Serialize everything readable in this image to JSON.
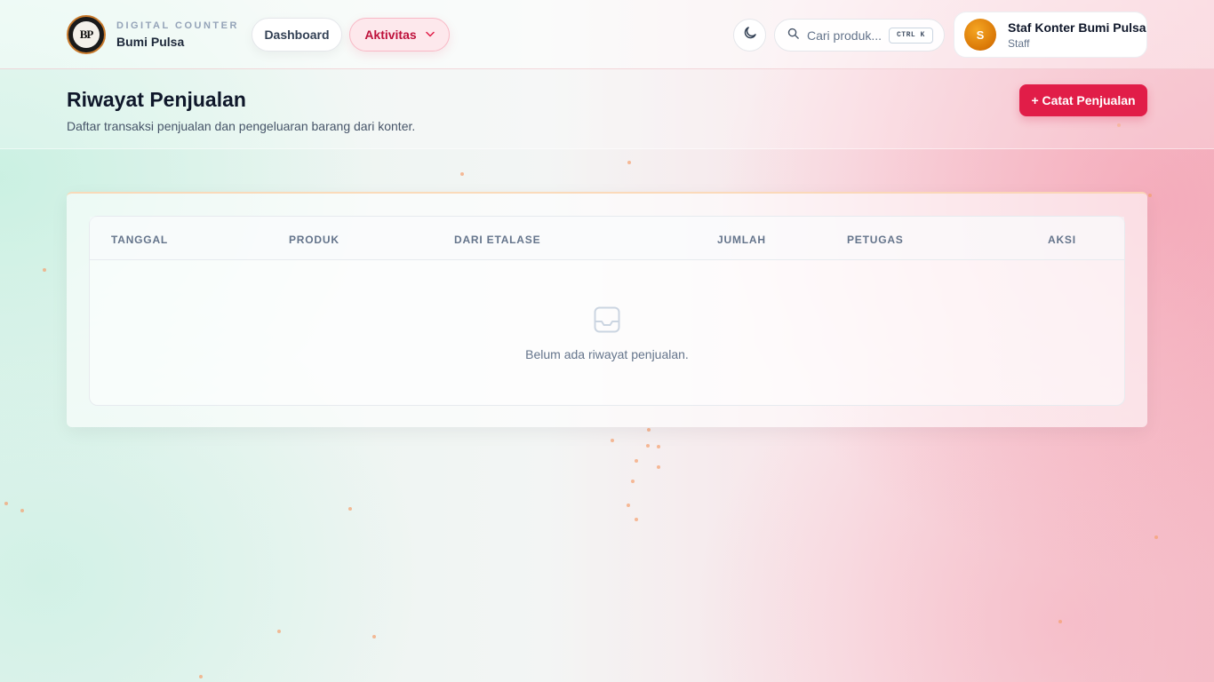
{
  "brand": {
    "logo_text": "BP",
    "subtitle": "DIGITAL COUNTER",
    "name": "Bumi Pulsa"
  },
  "nav": {
    "dashboard": "Dashboard",
    "aktivitas": "Aktivitas"
  },
  "search": {
    "placeholder": "Cari produk...",
    "shortcut": "CTRL K"
  },
  "user": {
    "initial": "S",
    "name": "Staf Konter Bumi Pulsa",
    "role": "Staff"
  },
  "page": {
    "title": "Riwayat Penjualan",
    "subtitle": "Daftar transaksi penjualan dan pengeluaran barang dari konter.",
    "add_button": "+ Catat Penjualan"
  },
  "table": {
    "columns": [
      "TANGGAL",
      "PRODUK",
      "DARI ETALASE",
      "JUMLAH",
      "PETUGAS",
      "AKSI"
    ],
    "empty_message": "Belum ada riwayat penjualan."
  },
  "colors": {
    "accent": "#e11d48",
    "accent_soft": "#fde8ec"
  }
}
